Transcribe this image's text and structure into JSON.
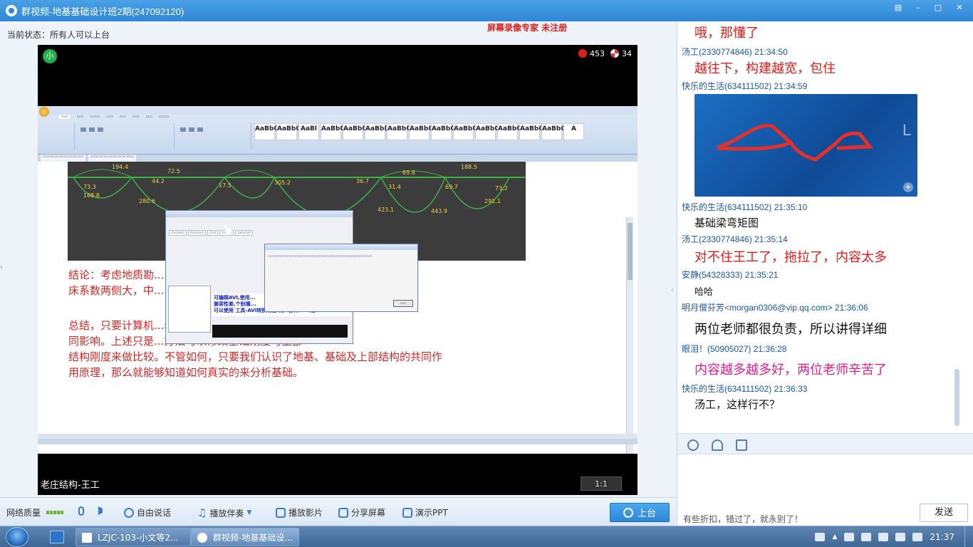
{
  "window": {
    "title": "群视频-地基基础设计班2期(247092120)"
  },
  "left": {
    "status": "当前状态：所有人可以上台",
    "watermark": "屏幕录像专家  未注册"
  },
  "video": {
    "badge": "小",
    "flowers": "453",
    "pinwheels": "34",
    "caption": "老庄结构-王工",
    "ratio": "1:1",
    "icons": [
      "flower-icon",
      "pinwheel-icon"
    ]
  },
  "shared_screen": {
    "doc_tab_1": "",
    "chart_values": [
      "194.4",
      "72.5",
      "69.8",
      "188.5",
      "73.3",
      "44.2",
      "17.5",
      "305.2",
      "36.7",
      "31.4",
      "69.7",
      "73.2",
      "168.8",
      "280.6",
      "423.1",
      "443.9",
      "291.1"
    ],
    "para1": "结论：考虑地质勘...，根据实情况，相应的基\n床系数两侧大，中...",
    "para2": "总结，只要计算机...着地基、基础及上部结构的共\n同影响。上述只是...方法可以修改基础刚度可上部\n结构刚度来做比较。不管如何，只要我们认识了地基、基础及上部结构的共同作\n用原理，那么就能够知道如何真实的来分析基础。",
    "recorder_banner": "可编辑AVI,使用...\n兼容性差,个别播...\n可以使用 工具-AVI转换功能 将声音转MP3后"
  },
  "toolbar": {
    "network": "网络质量",
    "free_talk": "自由说话",
    "accompany": "播放伴奏",
    "play_video": "播放影片",
    "share_screen": "分享屏幕",
    "present_ppt": "演示PPT",
    "go_stage": "上台"
  },
  "chat": {
    "messages": [
      {
        "body": "哦，那懂了"
      },
      {
        "head": "汤工(2330774846)  21:34:50",
        "body": "越往下，构建越宽，包住"
      },
      {
        "head": "快乐的生活(634111502)  21:34:59"
      },
      {
        "head": "快乐的生活(634111502)  21:35:10",
        "body": "基础梁弯矩图"
      },
      {
        "head": "汤工(2330774846)  21:35:14",
        "body": "对不住王工了，拖拉了，内容太多"
      },
      {
        "head": "安静(54328333)  21:35:21",
        "body": "哈哈"
      },
      {
        "head": "明月僧芬芳<morgan0306@vip.qq.com>  21:36:06",
        "body": "两位老师都很负责，所以讲得详细"
      },
      {
        "head": "眼泪！(50905027)  21:36:28",
        "body": "内容越多越多好，两位老师辛苦了"
      },
      {
        "head": "快乐的生活(634111502)  21:36:33",
        "body": "汤工，这样行不？"
      }
    ],
    "input_text": "有些折扣，错过了，就永别了！",
    "send": "发送"
  },
  "taskbar": {
    "task1": "LZJC-103-小文等2...",
    "task2": "群视频-地基基础设...",
    "clock": "21:37"
  }
}
